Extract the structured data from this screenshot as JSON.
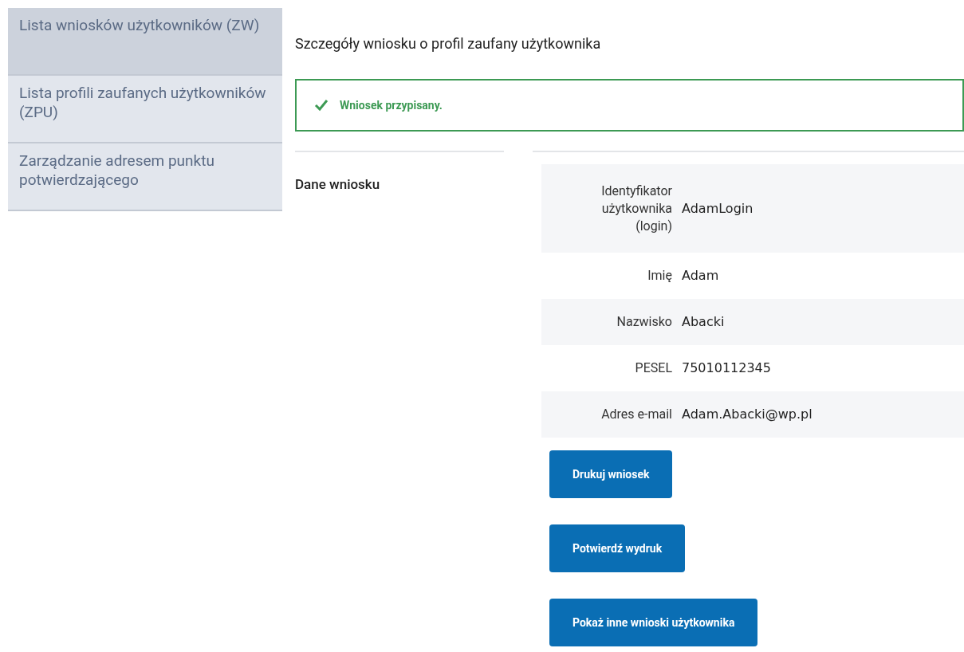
{
  "sidebar": {
    "items": [
      {
        "label": "Lista wniosków użytkowników (ZW)",
        "selected": true
      },
      {
        "label": "Lista profili zaufanych użytkowników (ZPU)",
        "selected": false
      },
      {
        "label": "Zarządzanie adresem punktu potwierdzającego",
        "selected": false
      }
    ]
  },
  "page_title": "Szczegóły wniosku o profil zaufany użytkownika",
  "alert": {
    "kind": "success",
    "message": "Wniosek przypisany."
  },
  "section_title": "Dane wniosku",
  "details": [
    {
      "label": "Identyfikator użytkownika (login)",
      "value": "AdamLogin"
    },
    {
      "label": "Imię",
      "value": "Adam"
    },
    {
      "label": "Nazwisko",
      "value": "Abacki"
    },
    {
      "label": "PESEL",
      "value": "75010112345"
    },
    {
      "label": "Adres e-mail",
      "value": "Adam.Abacki@wp.pl"
    }
  ],
  "buttons": [
    "Drukuj wniosek",
    "Potwierdź wydruk",
    "Pokaż inne wnioski użytkownika"
  ]
}
